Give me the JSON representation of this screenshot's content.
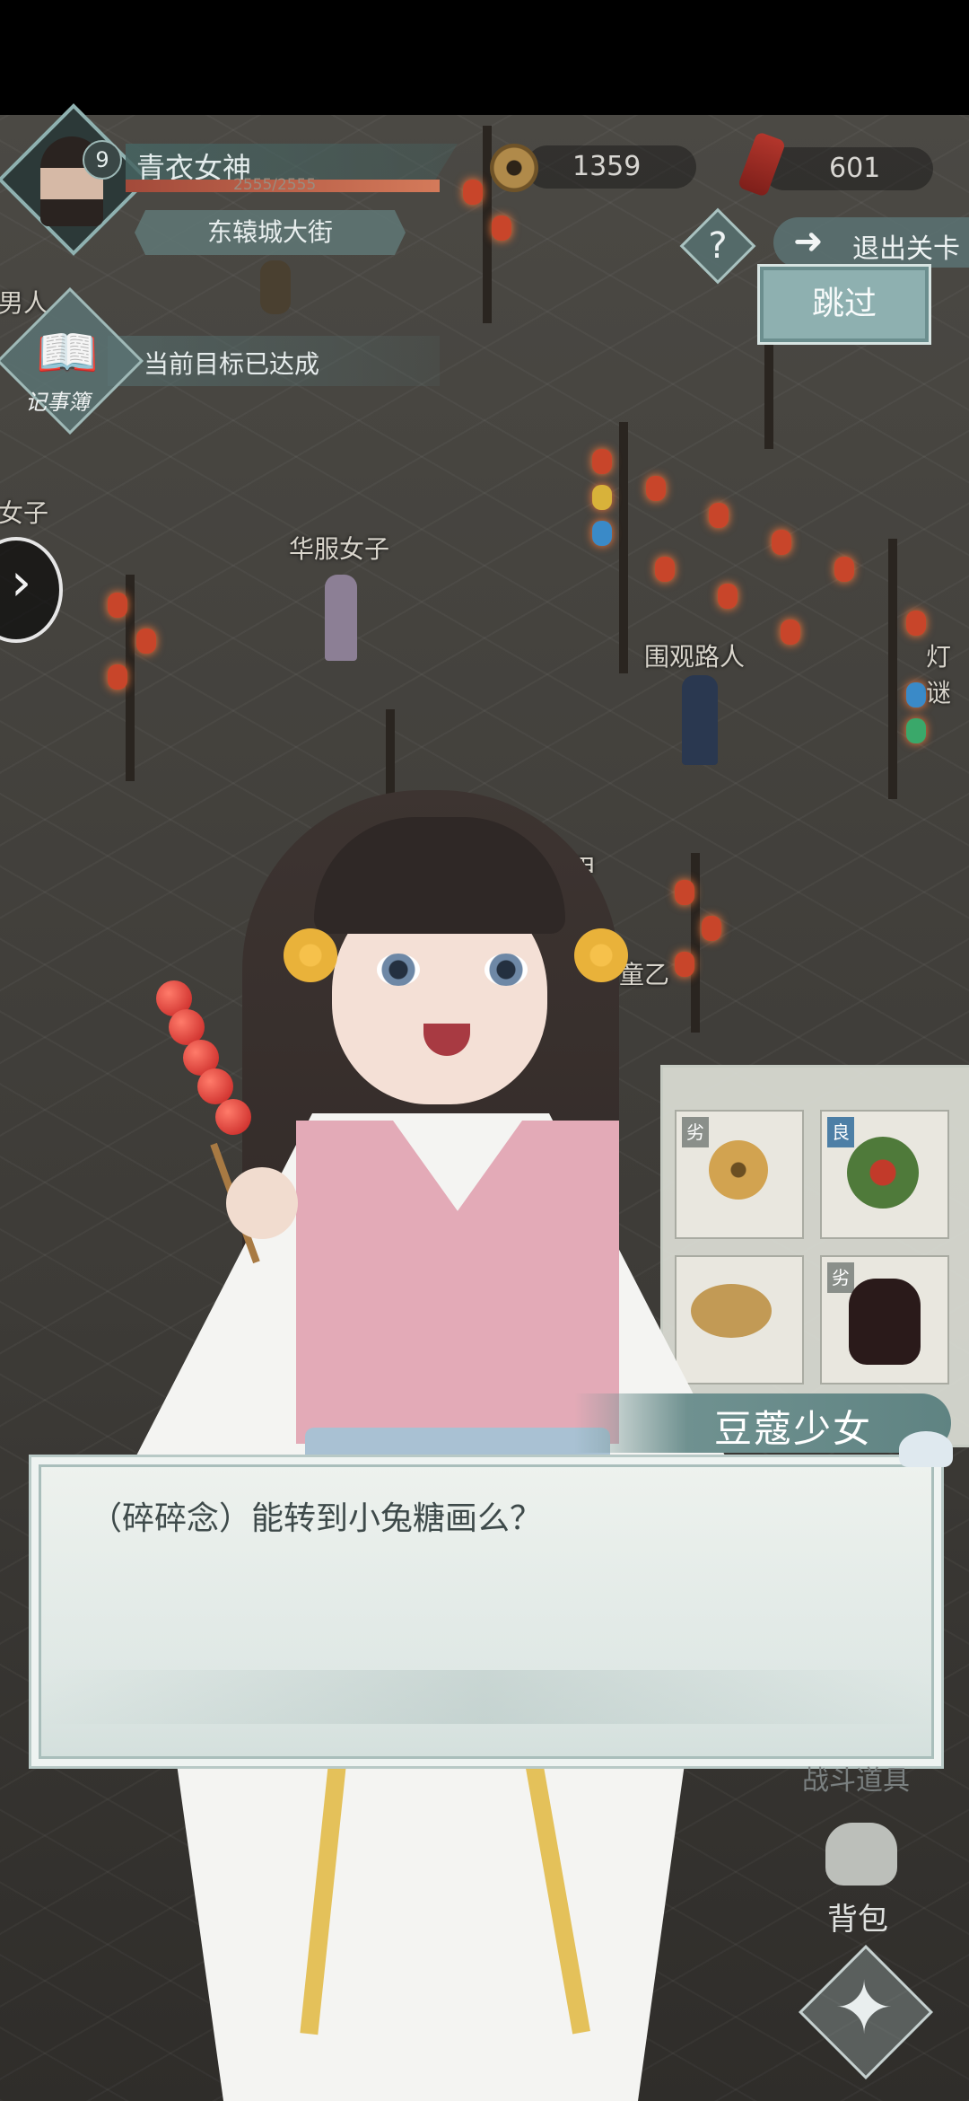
{
  "player": {
    "level": "9",
    "name": "青衣女神",
    "hp_text": "2555/2555",
    "hp_fraction": 1.0,
    "location": "东辕城大街"
  },
  "currency": {
    "coins": "1359",
    "tokens": "601"
  },
  "buttons": {
    "exit_label": "退出关卡",
    "skip_label": "跳过",
    "help_symbol": "?"
  },
  "journal": {
    "label": "记事簿",
    "objective": "当前目标已达成"
  },
  "npcs": [
    {
      "name": "男人"
    },
    {
      "name": "女子"
    },
    {
      "name": "华服女子"
    },
    {
      "name": "围观路人"
    },
    {
      "name": "灯谜"
    },
    {
      "name": "甲"
    },
    {
      "name": "童乙"
    }
  ],
  "items": [
    {
      "tag": "劣",
      "icon": "coins-icon",
      "tag_color": "#8a8f8a"
    },
    {
      "tag": "良",
      "icon": "herb-icon",
      "tag_color": "#4d7fa6"
    },
    {
      "tag": "",
      "icon": "plate-icon",
      "tag_color": "#8a8f8a"
    },
    {
      "tag": "劣",
      "icon": "wine-jar-icon",
      "tag_color": "#8a8f8a"
    }
  ],
  "dialog": {
    "speaker": "豆蔻少女",
    "text": "（碎碎念）能转到小兔糖画么？"
  },
  "menu": {
    "battle_items_label": "战斗道具",
    "bag_label": "背包"
  }
}
